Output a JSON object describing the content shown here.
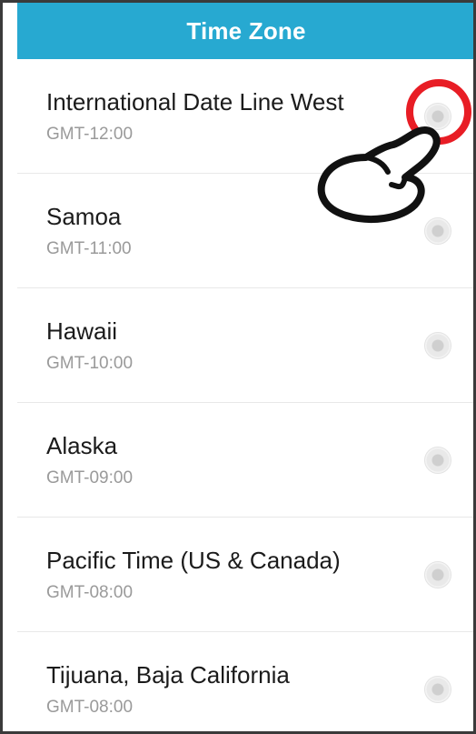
{
  "header": {
    "title": "Time Zone",
    "background": "#27a9d1"
  },
  "time_zones": [
    {
      "name": "International Date Line West",
      "offset": "GMT-12:00"
    },
    {
      "name": "Samoa",
      "offset": "GMT-11:00"
    },
    {
      "name": "Hawaii",
      "offset": "GMT-10:00"
    },
    {
      "name": "Alaska",
      "offset": "GMT-09:00"
    },
    {
      "name": "Pacific Time (US & Canada)",
      "offset": "GMT-08:00"
    },
    {
      "name": "Tijuana, Baja California",
      "offset": "GMT-08:00"
    }
  ],
  "annotations": {
    "highlight_color": "#e81d25",
    "pointer_icon": "tap-hand-icon"
  }
}
